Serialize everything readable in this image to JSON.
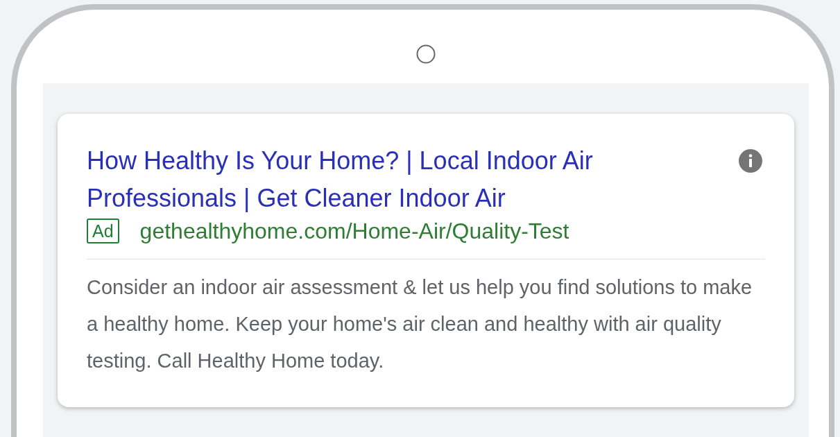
{
  "ad": {
    "title": "How Healthy Is Your Home? | Local Indoor Air Professionals | Get Cleaner Indoor Air",
    "badge": "Ad",
    "display_url": "gethealthyhome.com/Home-Air/Quality-Test",
    "description": "Consider an indoor air assessment & let us help you find solutions to make a healthy home. Keep your home's air clean and healthy with air quality testing. Call Healthy Home today."
  }
}
